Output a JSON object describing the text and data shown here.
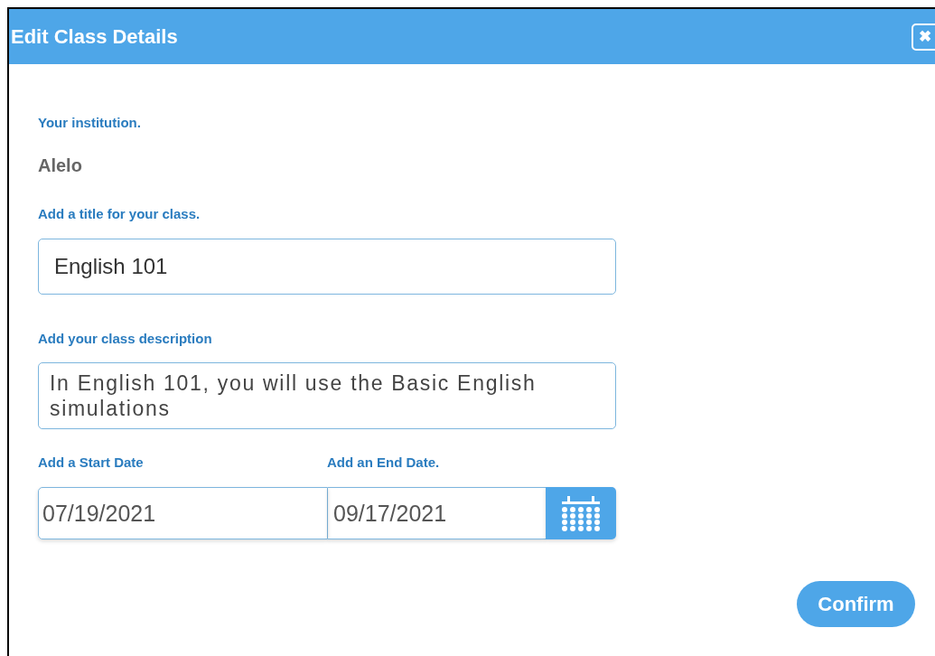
{
  "dialog": {
    "title": "Edit Class Details",
    "close_icon": "✖"
  },
  "institution": {
    "label": "Your institution.",
    "value": "Alelo"
  },
  "title_field": {
    "label": "Add a title for your class.",
    "value": "English 101"
  },
  "description_field": {
    "label": "Add your class description",
    "value": "In English 101, you will use the Basic English simulations"
  },
  "start_date": {
    "label": "Add a Start Date",
    "value": "07/19/2021"
  },
  "end_date": {
    "label": "Add an End Date.",
    "value": "09/17/2021"
  },
  "buttons": [
    {
      "label": "Confirm"
    }
  ]
}
